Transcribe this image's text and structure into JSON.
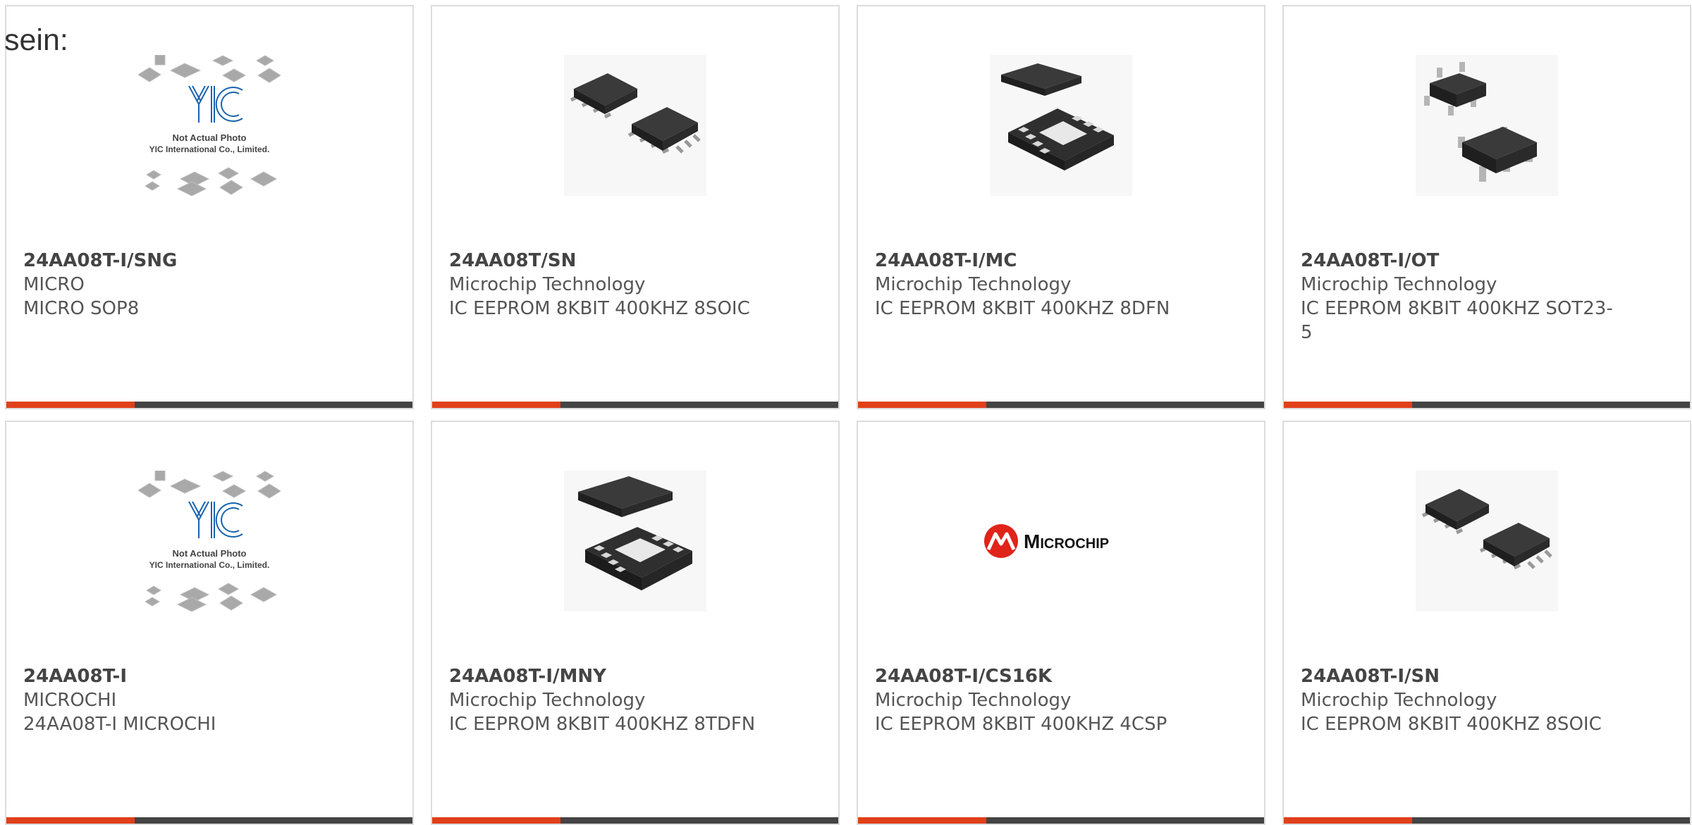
{
  "page": {
    "heading": "sein:"
  },
  "colors": {
    "accent": "#e0401a",
    "bar_dark": "#444444",
    "border": "#dcdcdc",
    "text": "#555555"
  },
  "products": [
    {
      "part_number": "24AA08T-I/SNG",
      "manufacturer": "MICRO",
      "description": "MICRO SOP8",
      "image": "yic-placeholder-image",
      "placeholder_text_1": "Not Actual Photo",
      "placeholder_text_2": "YIC International Co., Limited.",
      "logo_text": "YIC"
    },
    {
      "part_number": "24AA08T/SN",
      "manufacturer": "Microchip Technology",
      "description": "IC EEPROM 8KBIT 400KHZ 8SOIC",
      "image": "soic8-chip-image"
    },
    {
      "part_number": "24AA08T-I/MC",
      "manufacturer": "Microchip Technology",
      "description": "IC EEPROM 8KBIT 400KHZ 8DFN",
      "image": "dfn8-chip-image"
    },
    {
      "part_number": "24AA08T-I/OT",
      "manufacturer": "Microchip Technology",
      "description": "IC EEPROM 8KBIT 400KHZ SOT23-5",
      "image": "sot23-chip-image"
    },
    {
      "part_number": "24AA08T-I",
      "manufacturer": "MICROCHI",
      "description": "24AA08T-I MICROCHI",
      "image": "yic-placeholder-image",
      "placeholder_text_1": "Not Actual Photo",
      "placeholder_text_2": "YIC International Co., Limited.",
      "logo_text": "YIC"
    },
    {
      "part_number": "24AA08T-I/MNY",
      "manufacturer": "Microchip Technology",
      "description": "IC EEPROM 8KBIT 400KHZ 8TDFN",
      "image": "tdfn8-chip-image"
    },
    {
      "part_number": "24AA08T-I/CS16K",
      "manufacturer": "Microchip Technology",
      "description": "IC EEPROM 8KBIT 400KHZ 4CSP",
      "image": "microchip-logo-image",
      "logo_text": "Microchip"
    },
    {
      "part_number": "24AA08T-I/SN",
      "manufacturer": "Microchip Technology",
      "description": "IC EEPROM 8KBIT 400KHZ 8SOIC",
      "image": "soic8-chip-image"
    }
  ]
}
